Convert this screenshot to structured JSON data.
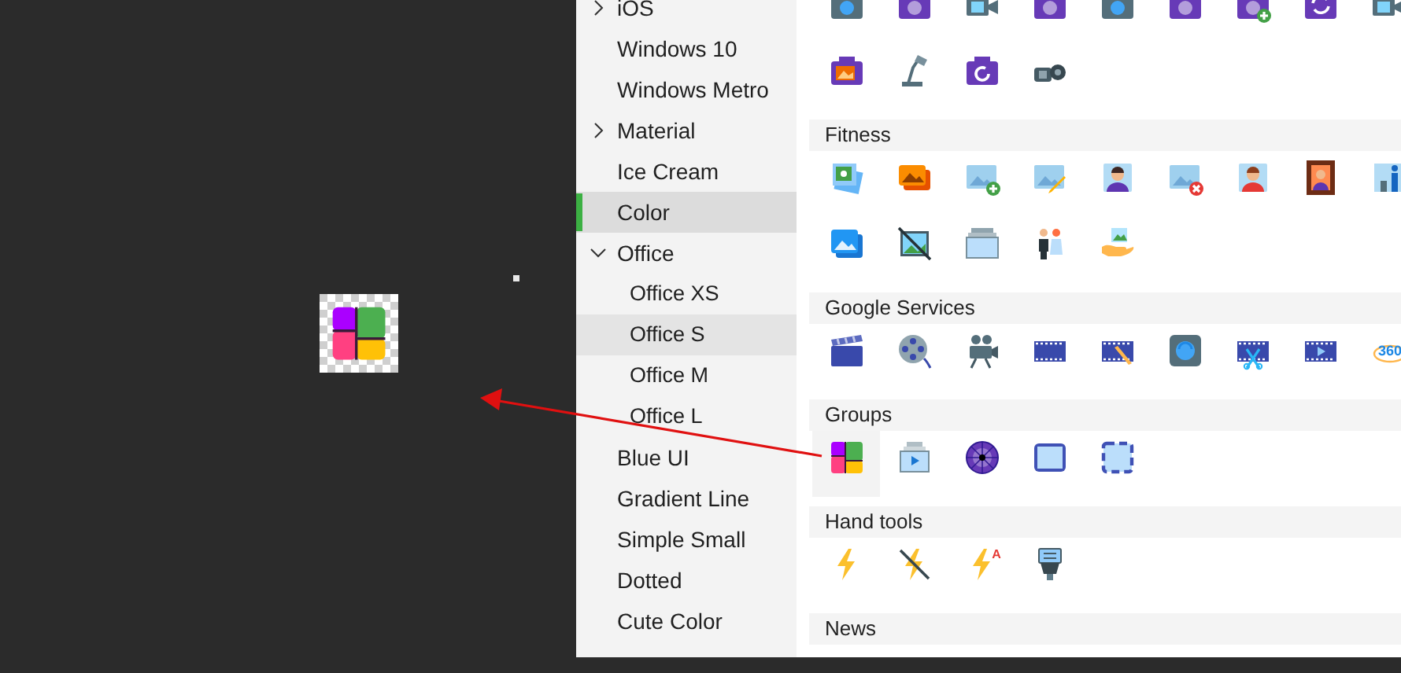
{
  "preview": {
    "kind": "color-grid"
  },
  "sidebar": {
    "items": [
      {
        "label": "iOS",
        "expanded": false,
        "selected": false,
        "hovered": false
      },
      {
        "label": "Windows 10",
        "selected": false,
        "hovered": false
      },
      {
        "label": "Windows Metro",
        "selected": false,
        "hovered": false
      },
      {
        "label": "Material",
        "expanded": false,
        "selected": false,
        "hovered": false
      },
      {
        "label": "Ice Cream",
        "selected": false,
        "hovered": false
      },
      {
        "label": "Color",
        "selected": true,
        "hovered": false
      },
      {
        "label": "Office",
        "expanded": true,
        "selected": false,
        "hovered": false,
        "children": [
          {
            "label": "Office XS",
            "selected": false,
            "hovered": false
          },
          {
            "label": "Office S",
            "selected": false,
            "hovered": true
          },
          {
            "label": "Office M",
            "selected": false,
            "hovered": false
          },
          {
            "label": "Office L",
            "selected": false,
            "hovered": false
          }
        ]
      },
      {
        "label": "Blue UI",
        "selected": false,
        "hovered": false
      },
      {
        "label": "Gradient Line",
        "selected": false,
        "hovered": false
      },
      {
        "label": "Simple Small",
        "selected": false,
        "hovered": false
      },
      {
        "label": "Dotted",
        "selected": false,
        "hovered": false
      },
      {
        "label": "Cute Color",
        "selected": false,
        "hovered": false
      }
    ]
  },
  "sections": [
    {
      "icons": [
        {
          "kind": "camera-blue",
          "selected": false
        },
        {
          "kind": "camera-purple",
          "selected": false
        },
        {
          "kind": "video-camera",
          "selected": false
        },
        {
          "kind": "camera-purple",
          "selected": false
        },
        {
          "kind": "camera-blue",
          "selected": false
        },
        {
          "kind": "camera-purple",
          "selected": false
        },
        {
          "kind": "camera-plus",
          "selected": false
        },
        {
          "kind": "camera-sync",
          "selected": false
        },
        {
          "kind": "video-camera",
          "selected": false
        },
        {
          "kind": "photo-camera",
          "selected": false
        },
        {
          "kind": "desk-lamp",
          "selected": false
        },
        {
          "kind": "camera-rotate",
          "selected": false
        },
        {
          "kind": "camcorder",
          "selected": false
        }
      ]
    },
    {
      "title": "Fitness",
      "icons": [
        {
          "kind": "photo-stack",
          "selected": false
        },
        {
          "kind": "photos",
          "selected": false
        },
        {
          "kind": "image-plus",
          "selected": false
        },
        {
          "kind": "image-edit",
          "selected": false
        },
        {
          "kind": "man-picture",
          "selected": false
        },
        {
          "kind": "image-remove",
          "selected": false
        },
        {
          "kind": "woman-picture",
          "selected": false
        },
        {
          "kind": "framed-portrait",
          "selected": false
        },
        {
          "kind": "person-picture",
          "selected": false
        },
        {
          "kind": "image-stack",
          "selected": false
        },
        {
          "kind": "no-image",
          "selected": false
        },
        {
          "kind": "empty-stack",
          "selected": false
        },
        {
          "kind": "couple",
          "selected": false
        },
        {
          "kind": "hand-picture",
          "selected": false
        }
      ]
    },
    {
      "title": "Google Services",
      "icons": [
        {
          "kind": "clapperboard",
          "selected": false
        },
        {
          "kind": "film-reel",
          "selected": false
        },
        {
          "kind": "movie-camera",
          "selected": false
        },
        {
          "kind": "film-strip",
          "selected": false
        },
        {
          "kind": "film-edit",
          "selected": false
        },
        {
          "kind": "lens-square",
          "selected": false
        },
        {
          "kind": "film-cut",
          "selected": false
        },
        {
          "kind": "film-play",
          "selected": false
        },
        {
          "kind": "view-360",
          "label": "360",
          "selected": false
        }
      ]
    },
    {
      "title": "Groups",
      "icons": [
        {
          "kind": "color-grid",
          "selected": true
        },
        {
          "kind": "slideshow",
          "selected": false
        },
        {
          "kind": "aperture",
          "selected": false
        },
        {
          "kind": "frame",
          "selected": false
        },
        {
          "kind": "selection",
          "selected": false
        }
      ]
    },
    {
      "title": "Hand tools",
      "icons": [
        {
          "kind": "flash",
          "selected": false
        },
        {
          "kind": "flash-off",
          "selected": false
        },
        {
          "kind": "flash-auto",
          "label": "A",
          "selected": false
        },
        {
          "kind": "speedlight",
          "selected": false
        }
      ]
    },
    {
      "title": "News"
    }
  ]
}
